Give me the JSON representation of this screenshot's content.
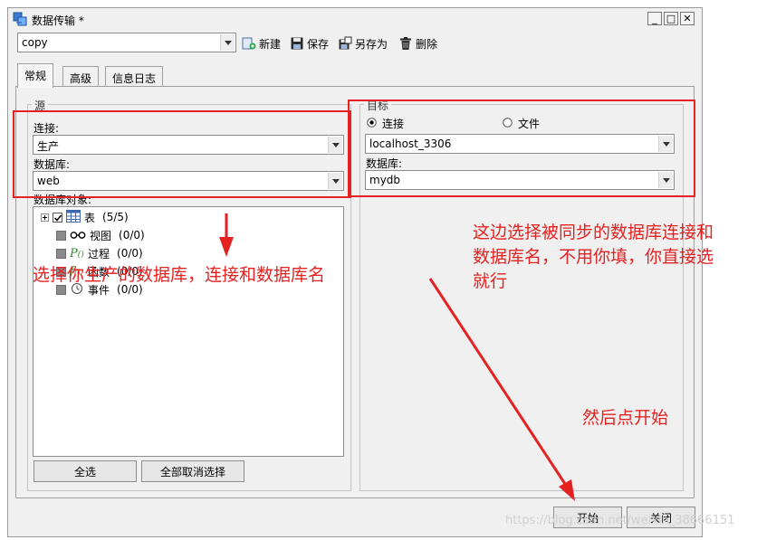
{
  "window": {
    "title": "数据传输 *",
    "controls": {
      "minimize": "_",
      "maximize": "□",
      "close": "✕"
    }
  },
  "toolbar": {
    "profile_value": "copy",
    "new_label": "新建",
    "save_label": "保存",
    "save_as_label": "另存为",
    "delete_label": "删除"
  },
  "tabs": [
    {
      "label": "常规",
      "active": true
    },
    {
      "label": "高级",
      "active": false
    },
    {
      "label": "信息日志",
      "active": false
    }
  ],
  "source": {
    "legend": "源",
    "connection_label": "连接:",
    "connection_value": "生产",
    "database_label": "数据库:",
    "database_value": "web",
    "objects_label": "数据库对象:",
    "tree": [
      {
        "label": "表",
        "count": "(5/5)",
        "icon": "table-icon"
      },
      {
        "label": "视图",
        "count": "(0/0)",
        "icon": "view-icon"
      },
      {
        "label": "过程",
        "count": "(0/0)",
        "icon": "procedure-icon"
      },
      {
        "label": "函数",
        "count": "(0/0)",
        "icon": "function-icon"
      },
      {
        "label": "事件",
        "count": "(0/0)",
        "icon": "event-icon"
      }
    ],
    "select_all": "全选",
    "deselect_all": "全部取消选择"
  },
  "target": {
    "legend": "目标",
    "radio_connection": "连接",
    "radio_file": "文件",
    "connection_value": "localhost_3306",
    "database_label": "数据库:",
    "database_value": "mydb"
  },
  "footer": {
    "start": "开始",
    "close": "关闭"
  },
  "annotations": {
    "left": "选择你生产的数据库，连接和数据库名",
    "right_line1": "这边选择被同步的数据库连接和",
    "right_line2": "数据库名，不用你填，你直接选",
    "right_line3": "就行",
    "start_note": "然后点开始"
  },
  "watermark": "https://blog.csdn.net/weixin_38666151",
  "colors": {
    "annotation": "#e52222",
    "window_bg": "#f0f0f0"
  }
}
